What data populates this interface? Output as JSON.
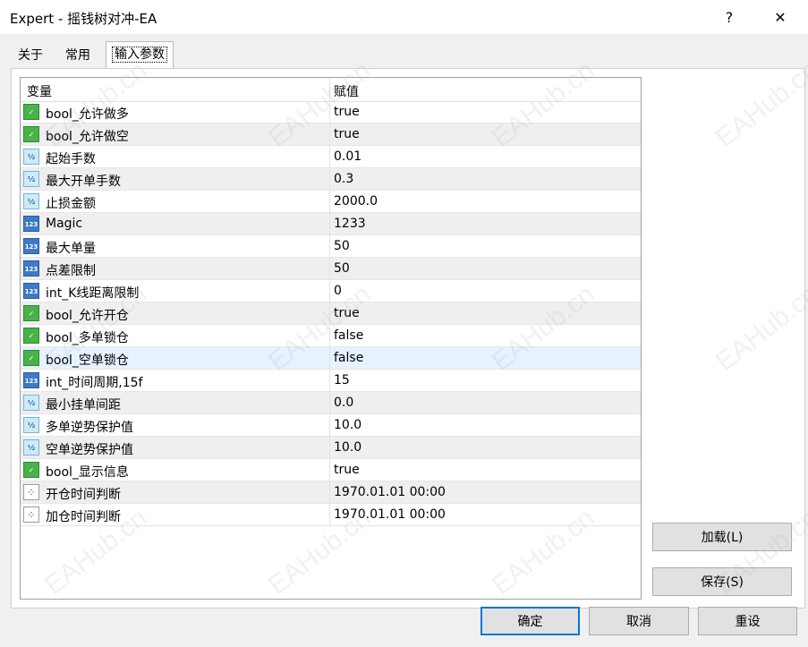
{
  "window": {
    "title": "Expert - 摇钱树对冲-EA",
    "help_glyph": "?",
    "close_glyph": "✕"
  },
  "tabs": [
    "关于",
    "常用",
    "输入参数"
  ],
  "grid": {
    "headers": {
      "variable": "变量",
      "value": "赋值"
    },
    "rows": [
      {
        "icon": "bool-icon",
        "glyph": "✓",
        "name": "bool_允许做多",
        "value": "true"
      },
      {
        "icon": "bool-icon",
        "glyph": "✓",
        "name": "bool_允许做空",
        "value": "true"
      },
      {
        "icon": "double-icon",
        "glyph": "½",
        "name": "起始手数",
        "value": "0.01"
      },
      {
        "icon": "double-icon",
        "glyph": "½",
        "name": "最大开单手数",
        "value": "0.3"
      },
      {
        "icon": "double-icon",
        "glyph": "½",
        "name": "止损金额",
        "value": "2000.0"
      },
      {
        "icon": "int-icon",
        "glyph": "123",
        "name": "Magic",
        "value": "1233"
      },
      {
        "icon": "int-icon",
        "glyph": "123",
        "name": "最大单量",
        "value": "50"
      },
      {
        "icon": "int-icon",
        "glyph": "123",
        "name": "点差限制",
        "value": "50"
      },
      {
        "icon": "int-icon",
        "glyph": "123",
        "name": "int_K线距离限制",
        "value": "0"
      },
      {
        "icon": "bool-icon",
        "glyph": "✓",
        "name": "bool_允许开仓",
        "value": "true"
      },
      {
        "icon": "bool-icon",
        "glyph": "✓",
        "name": "bool_多单锁仓",
        "value": "false"
      },
      {
        "icon": "bool-icon",
        "glyph": "✓",
        "name": "bool_空单锁仓",
        "value": "false"
      },
      {
        "icon": "int-icon",
        "glyph": "123",
        "name": "int_时间周期,15f",
        "value": "15"
      },
      {
        "icon": "double-icon",
        "glyph": "½",
        "name": "最小挂单间距",
        "value": "0.0"
      },
      {
        "icon": "double-icon",
        "glyph": "½",
        "name": "多单逆势保护值",
        "value": "10.0"
      },
      {
        "icon": "double-icon",
        "glyph": "½",
        "name": "空单逆势保护值",
        "value": "10.0"
      },
      {
        "icon": "bool-icon",
        "glyph": "✓",
        "name": "bool_显示信息",
        "value": "true"
      },
      {
        "icon": "datetime-icon",
        "glyph": "⁘",
        "name": "开仓时间判断",
        "value": "1970.01.01 00:00"
      },
      {
        "icon": "datetime-icon",
        "glyph": "⁘",
        "name": "加仓时间判断",
        "value": "1970.01.01 00:00"
      }
    ]
  },
  "buttons": {
    "load": "加载(L)",
    "save": "保存(S)",
    "ok": "确定",
    "cancel": "取消",
    "reset": "重设"
  },
  "watermark": "EAHub.cn"
}
